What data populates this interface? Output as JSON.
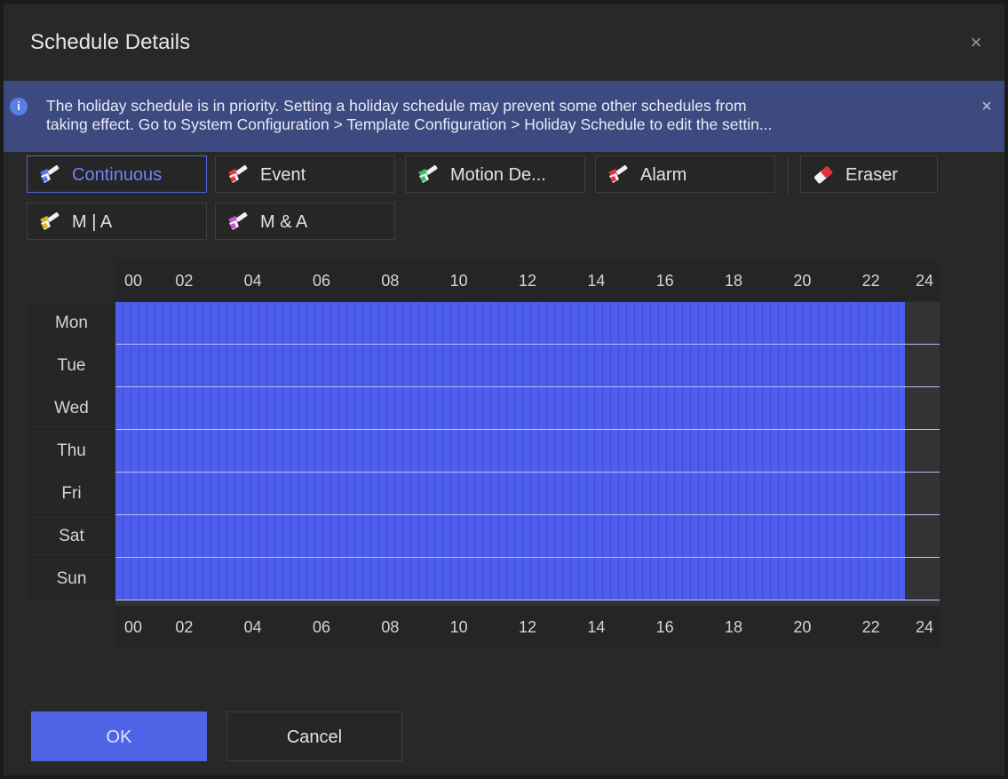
{
  "dialog": {
    "title": "Schedule Details",
    "close_label": "×"
  },
  "banner": {
    "info_glyph": "i",
    "line1": "The holiday schedule is in priority. Setting a holiday schedule may prevent some other schedules from",
    "line2": "taking effect. Go to System Configuration > Template Configuration > Holiday Schedule to edit the settin...",
    "close_label": "×"
  },
  "tools": [
    {
      "label": "Continuous",
      "icon": "brush-icon",
      "color": "#5b74ff",
      "active": true
    },
    {
      "label": "Event",
      "icon": "brush-icon",
      "color": "#e23c3c",
      "active": false
    },
    {
      "label": "Motion De...",
      "icon": "brush-icon",
      "color": "#2fbf6a",
      "active": false
    },
    {
      "label": "Alarm",
      "icon": "brush-icon",
      "color": "#e6313b",
      "active": false
    },
    {
      "label": "Eraser",
      "icon": "eraser-icon",
      "color": "#e6313b",
      "active": false
    },
    {
      "label": "M | A",
      "icon": "brush-icon",
      "color": "#e0b020",
      "active": false
    },
    {
      "label": "M & A",
      "icon": "brush-icon",
      "color": "#c84fd2",
      "active": false
    }
  ],
  "schedule": {
    "hour_labels": [
      "00",
      "02",
      "04",
      "06",
      "08",
      "10",
      "12",
      "14",
      "16",
      "18",
      "20",
      "22",
      "24"
    ],
    "days": [
      "Mon",
      "Tue",
      "Wed",
      "Thu",
      "Fri",
      "Sat",
      "Sun"
    ],
    "filled_hours_per_day": [
      23,
      23,
      23,
      23,
      23,
      23,
      23
    ],
    "fill_color": "#4d5ded"
  },
  "buttons": {
    "ok": "OK",
    "cancel": "Cancel"
  }
}
